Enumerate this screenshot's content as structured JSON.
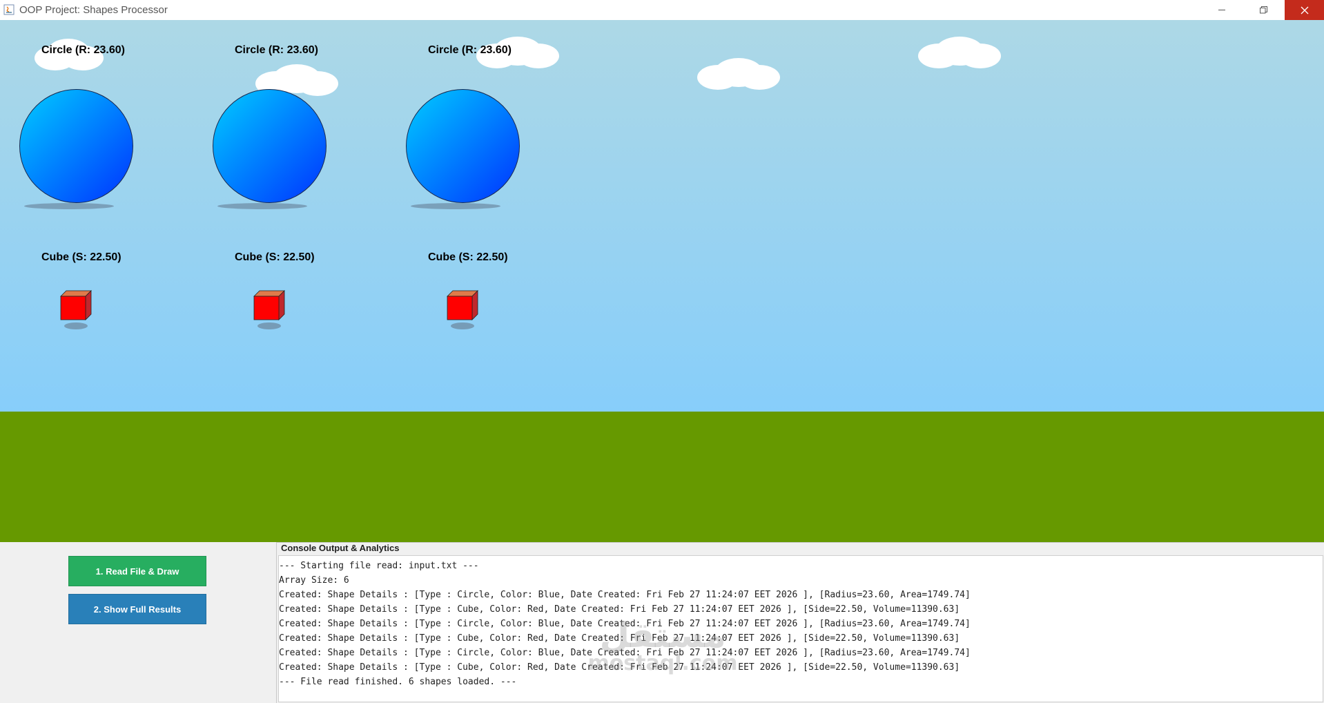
{
  "window": {
    "title": "OOP Project: Shapes Processor",
    "icons": {
      "app": "java-app-icon",
      "minimize": "minimize-icon",
      "maximize": "restore-icon",
      "close": "close-icon"
    },
    "close_color": "#c42b1c"
  },
  "scene": {
    "sky_colors": [
      "#add8e6",
      "#87cefa"
    ],
    "ground_color": "#669900",
    "circles": [
      {
        "label": "Circle (R: 23.60)",
        "type": "Circle",
        "color": "Blue",
        "radius": "23.60"
      },
      {
        "label": "Circle (R: 23.60)",
        "type": "Circle",
        "color": "Blue",
        "radius": "23.60"
      },
      {
        "label": "Circle (R: 23.60)",
        "type": "Circle",
        "color": "Blue",
        "radius": "23.60"
      }
    ],
    "cubes": [
      {
        "label": "Cube (S: 22.50)",
        "type": "Cube",
        "color": "Red",
        "side": "22.50"
      },
      {
        "label": "Cube (S: 22.50)",
        "type": "Cube",
        "color": "Red",
        "side": "22.50"
      },
      {
        "label": "Cube (S: 22.50)",
        "type": "Cube",
        "color": "Red",
        "side": "22.50"
      }
    ]
  },
  "controls": {
    "read_button": {
      "label": "1. Read File & Draw",
      "color": "#27ae60"
    },
    "show_button": {
      "label": "2. Show Full Results",
      "color": "#2980b9"
    }
  },
  "console": {
    "title": "Console Output & Analytics",
    "lines": [
      "--- Starting file read: input.txt ---",
      "Array Size: 6",
      "Created: Shape Details : [Type : Circle, Color: Blue, Date Created: Fri Feb 27 11:24:07 EET 2026 ], [Radius=23.60, Area=1749.74]",
      "Created: Shape Details : [Type : Cube, Color: Red, Date Created: Fri Feb 27 11:24:07 EET 2026 ], [Side=22.50, Volume=11390.63]",
      "Created: Shape Details : [Type : Circle, Color: Blue, Date Created: Fri Feb 27 11:24:07 EET 2026 ], [Radius=23.60, Area=1749.74]",
      "Created: Shape Details : [Type : Cube, Color: Red, Date Created: Fri Feb 27 11:24:07 EET 2026 ], [Side=22.50, Volume=11390.63]",
      "Created: Shape Details : [Type : Circle, Color: Blue, Date Created: Fri Feb 27 11:24:07 EET 2026 ], [Radius=23.60, Area=1749.74]",
      "Created: Shape Details : [Type : Cube, Color: Red, Date Created: Fri Feb 27 11:24:07 EET 2026 ], [Side=22.50, Volume=11390.63]",
      "--- File read finished. 6 shapes loaded. ---"
    ]
  },
  "watermark": {
    "top": "مستقل",
    "bottom": "mostaql.com"
  }
}
